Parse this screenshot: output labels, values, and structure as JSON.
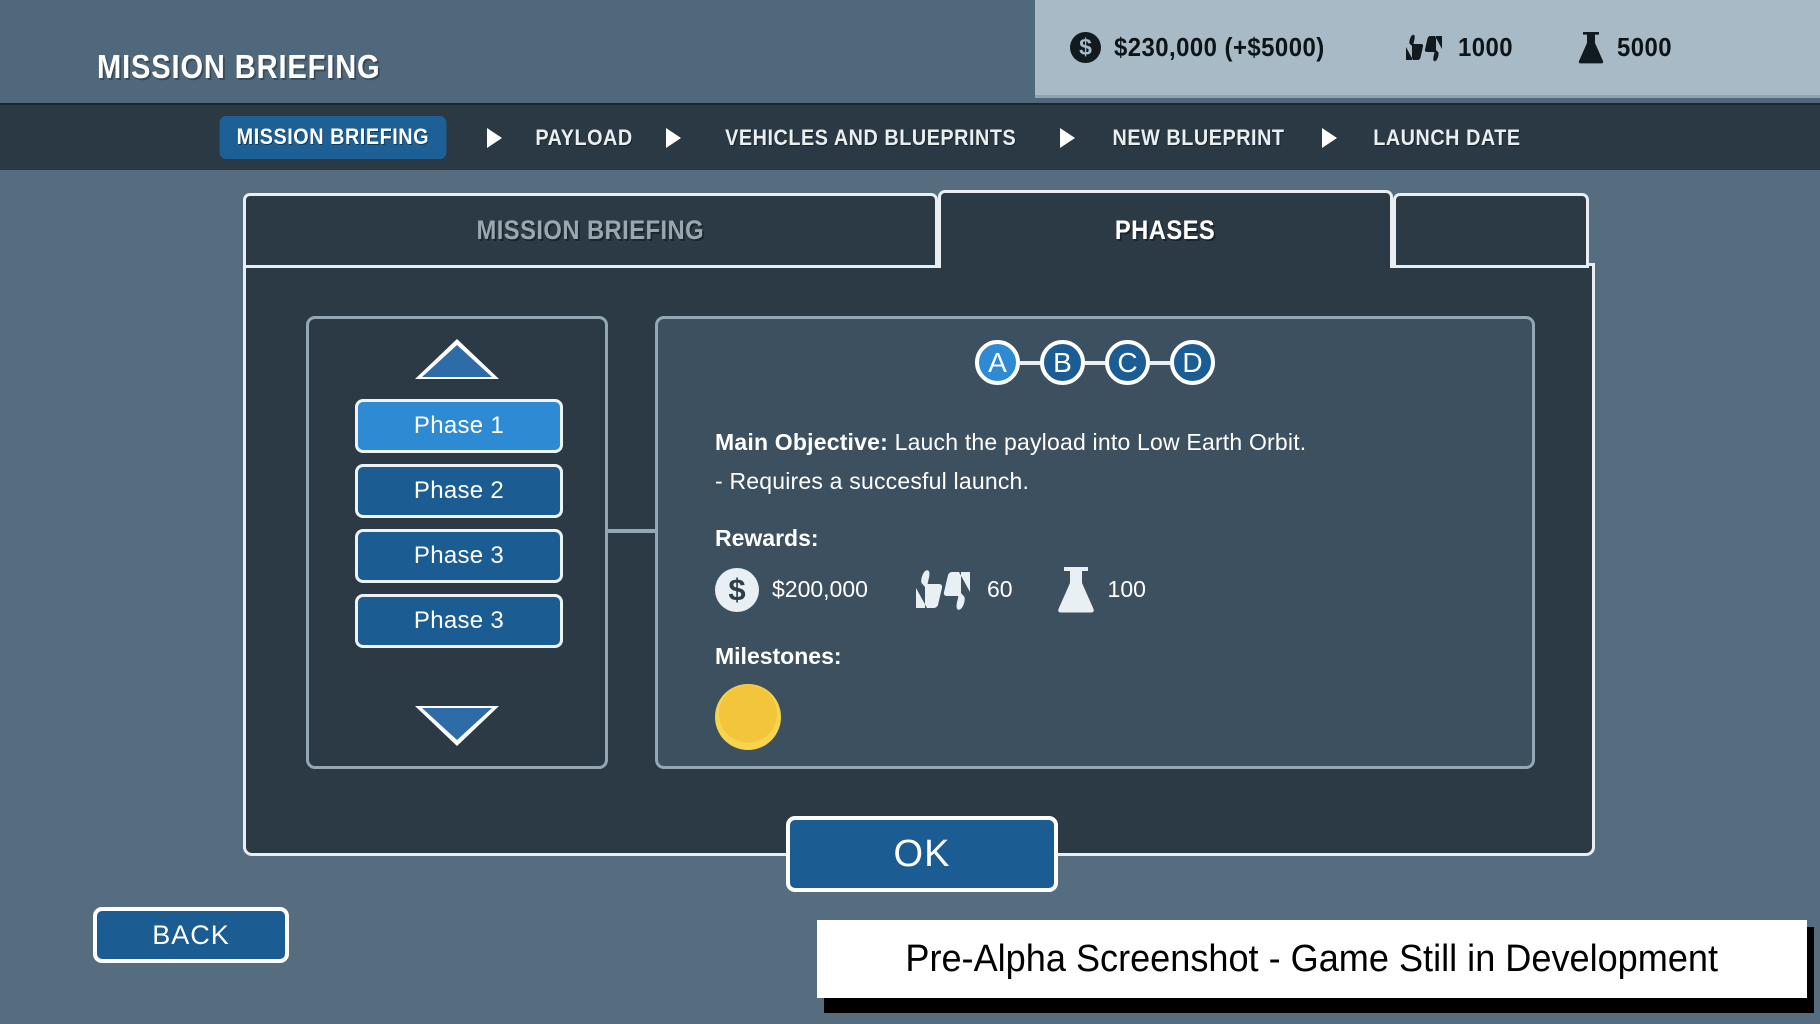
{
  "header": {
    "title": "MISSION BRIEFING"
  },
  "resources": [
    {
      "icon": "money-icon",
      "value": "$230,000 (+$5000)"
    },
    {
      "icon": "reputation-icon",
      "value": "1000"
    },
    {
      "icon": "science-icon",
      "value": "5000"
    }
  ],
  "breadcrumb": {
    "items": [
      {
        "label": "MISSION BRIEFING",
        "active": true
      },
      {
        "label": "PAYLOAD",
        "active": false
      },
      {
        "label": "VEHICLES AND BLUEPRINTS",
        "active": false
      },
      {
        "label": "NEW BLUEPRINT",
        "active": false
      },
      {
        "label": "LAUNCH DATE",
        "active": false
      }
    ]
  },
  "tabs": [
    {
      "label": "MISSION BRIEFING",
      "active": false
    },
    {
      "label": "PHASES",
      "active": true
    },
    {
      "label": "",
      "active": false
    }
  ],
  "phase_list": {
    "scroll_up": "scroll-up-arrow",
    "scroll_down": "scroll-down-arrow",
    "items": [
      {
        "label": "Phase 1",
        "selected": true
      },
      {
        "label": "Phase 2",
        "selected": false
      },
      {
        "label": "Phase 3",
        "selected": false
      },
      {
        "label": "Phase 3",
        "selected": false
      }
    ]
  },
  "detail": {
    "nodes": [
      {
        "label": "A",
        "active": true
      },
      {
        "label": "B",
        "active": false
      },
      {
        "label": "C",
        "active": false
      },
      {
        "label": "D",
        "active": false
      }
    ],
    "objective_label": "Main Objective:",
    "objective_text": " Lauch the payload into Low Earth Orbit.",
    "requirement": "- Requires a succesful launch.",
    "rewards_label": "Rewards:",
    "rewards": [
      {
        "icon": "money-icon",
        "value": "$200,000"
      },
      {
        "icon": "reputation-icon",
        "value": "60"
      },
      {
        "icon": "science-icon",
        "value": "100"
      }
    ],
    "milestones_label": "Milestones:",
    "milestone_icon": "gold-coin-icon"
  },
  "footer": {
    "ok_label": "OK",
    "back_label": "BACK",
    "watermark": "Pre-Alpha Screenshot - Game Still in Development"
  },
  "colors": {
    "background": "#566d80",
    "panel": "#2b3a45",
    "detail_panel": "#3d5060",
    "accent_blue": "#1b5c93",
    "accent_blue_light": "#2e8ad2",
    "border_light": "#e8eef2",
    "resource_bar": "#a8bac6",
    "gold": "#f3c53a"
  }
}
